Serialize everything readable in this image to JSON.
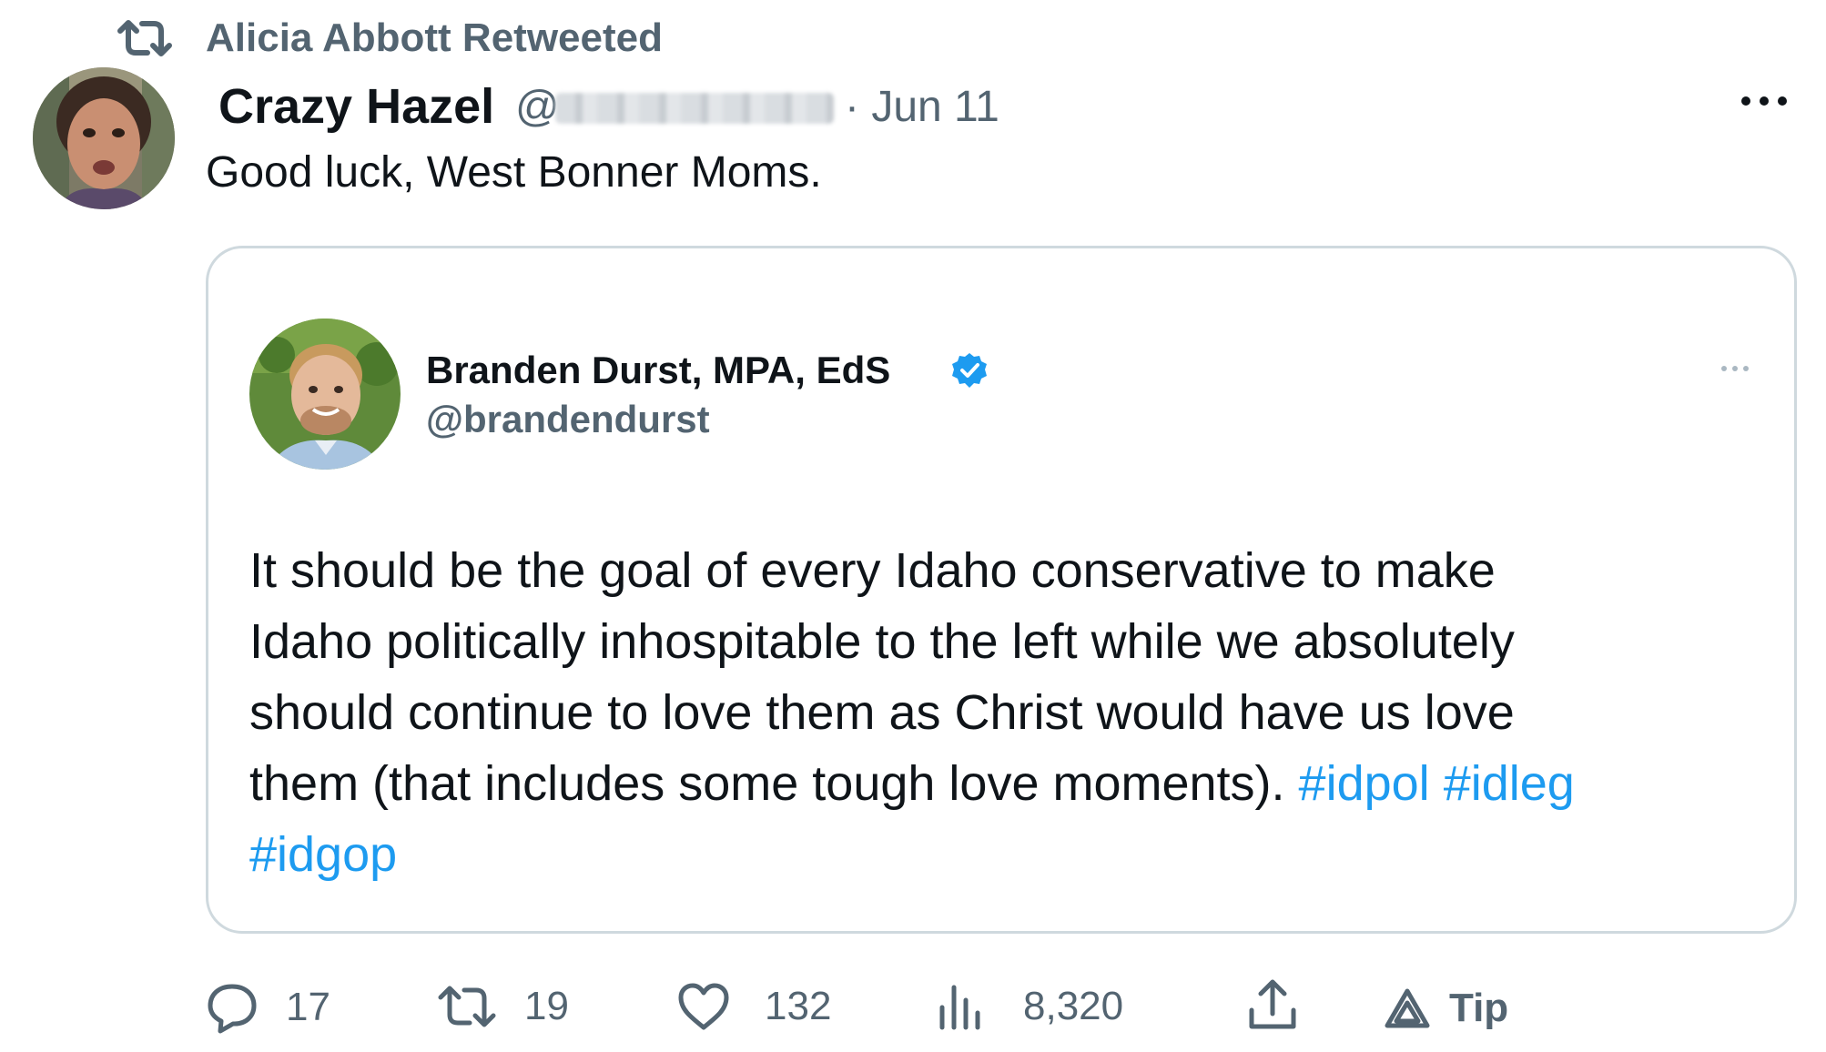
{
  "retweet": {
    "label": "Alicia Abbott Retweeted"
  },
  "tweet": {
    "author_name": "Crazy Hazel",
    "handle_prefix": "@",
    "date": "· Jun 11",
    "text": "Good luck, West Bonner Moms."
  },
  "quote": {
    "author_name": "Branden Durst, MPA, EdS",
    "handle": "@brandendurst",
    "text_lines": [
      "It should be the goal of every Idaho conservative to make",
      "Idaho politically inhospitable to the left while we absolutely",
      "should continue to love them as Christ would have us love",
      "them (that includes some tough love moments). "
    ],
    "hashtags": [
      "#idpol",
      "#idleg",
      "#idgop"
    ]
  },
  "actions": {
    "replies": "17",
    "retweets": "19",
    "likes": "132",
    "views": "8,320",
    "tip": "Tip"
  },
  "icons": {
    "retweet_header": "retweet-icon",
    "more": "more-horizontal-icon",
    "verified": "verified-badge-icon",
    "reply": "reply-icon",
    "retweet": "retweet-icon",
    "like": "heart-icon",
    "views": "views-chart-icon",
    "share": "share-icon",
    "tip": "tip-icon"
  },
  "colors": {
    "text": "#0f1419",
    "secondary": "#536471",
    "link": "#1d9bf0",
    "border": "#cfd9de"
  }
}
